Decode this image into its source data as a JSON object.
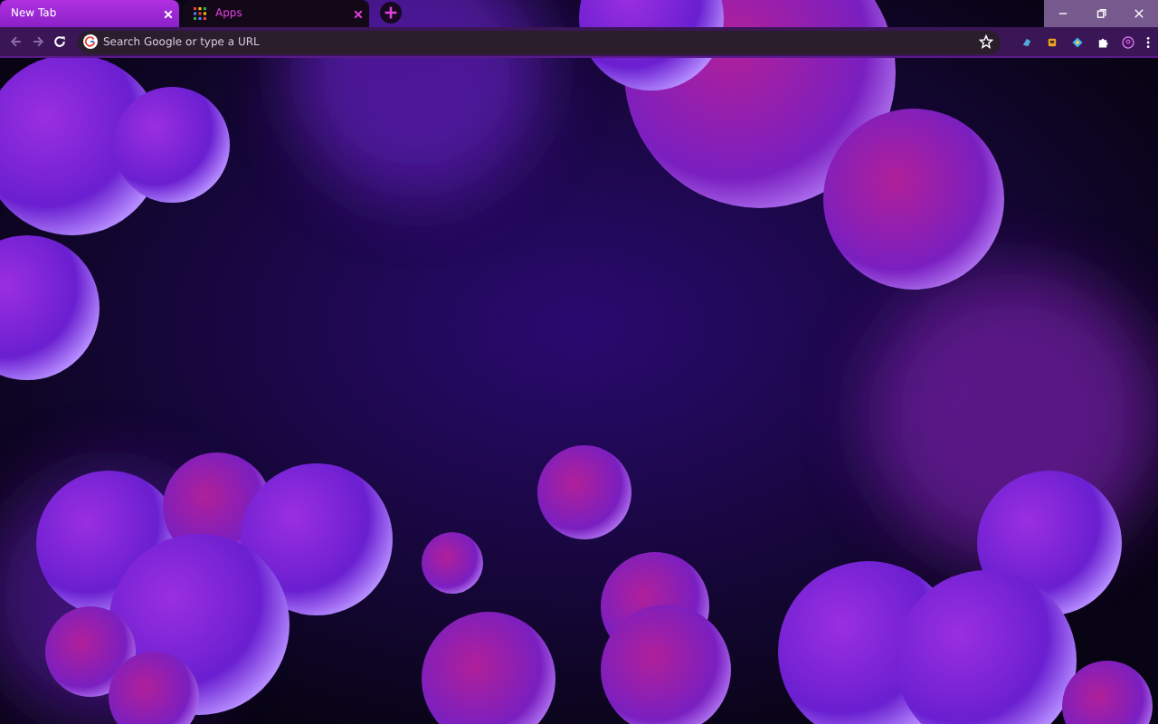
{
  "tabs": [
    {
      "title": "New Tab",
      "selected": true
    },
    {
      "title": "Apps",
      "selected": false
    }
  ],
  "omnibox": {
    "placeholder": "Search Google or type a URL"
  }
}
